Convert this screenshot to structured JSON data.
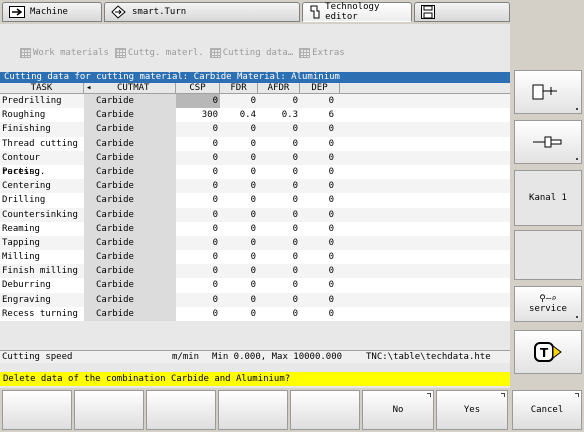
{
  "tabs": [
    {
      "label": "Machine",
      "icon": "arrow-right-icon"
    },
    {
      "label": "smart.Turn",
      "icon": "arrow-diamond-icon"
    },
    {
      "label": "Technology editor",
      "icon": "tool-icon"
    },
    {
      "label": "",
      "icon": "save-icon"
    }
  ],
  "menu": [
    "Work materials",
    "Cuttg. materl.",
    "Cutting data…",
    "Extras"
  ],
  "table": {
    "title": "Cutting data for cutting material: Carbide   Material: Aluminium",
    "columns": [
      "TASK",
      "CUTMAT",
      "CSP",
      "FDR",
      "AFDR",
      "DEP"
    ],
    "rows": [
      [
        "Predrilling",
        "Carbide",
        "0",
        "0",
        "0",
        "0"
      ],
      [
        "Roughing",
        "Carbide",
        "300",
        "0.4",
        "0.3",
        "6"
      ],
      [
        "Finishing",
        "Carbide",
        "0",
        "0",
        "0",
        "0"
      ],
      [
        "Thread cutting",
        "Carbide",
        "0",
        "0",
        "0",
        "0"
      ],
      [
        "Contour recessg.",
        "Carbide",
        "0",
        "0",
        "0",
        "0"
      ],
      [
        "Parting",
        "Carbide",
        "0",
        "0",
        "0",
        "0"
      ],
      [
        "Centering",
        "Carbide",
        "0",
        "0",
        "0",
        "0"
      ],
      [
        "Drilling",
        "Carbide",
        "0",
        "0",
        "0",
        "0"
      ],
      [
        "Countersinking",
        "Carbide",
        "0",
        "0",
        "0",
        "0"
      ],
      [
        "Reaming",
        "Carbide",
        "0",
        "0",
        "0",
        "0"
      ],
      [
        "Tapping",
        "Carbide",
        "0",
        "0",
        "0",
        "0"
      ],
      [
        "Milling",
        "Carbide",
        "0",
        "0",
        "0",
        "0"
      ],
      [
        "Finish milling",
        "Carbide",
        "0",
        "0",
        "0",
        "0"
      ],
      [
        "Deburring",
        "Carbide",
        "0",
        "0",
        "0",
        "0"
      ],
      [
        "Engraving",
        "Carbide",
        "0",
        "0",
        "0",
        "0"
      ],
      [
        "Recess turning",
        "Carbide",
        "0",
        "0",
        "0",
        "0"
      ]
    ]
  },
  "status": {
    "field": "Cutting speed",
    "unit": "m/min",
    "range": "Min 0.000, Max 10000.000",
    "path": "TNC:\\table\\techdata.hte"
  },
  "message": "Delete data of the combination Carbide and Aluminium?",
  "right_softkeys": [
    {
      "label": "",
      "icon": "tool-holder-icon"
    },
    {
      "label": "",
      "icon": "spindle-icon"
    },
    {
      "label": "Kanal 1",
      "icon": ""
    },
    {
      "label": "",
      "icon": ""
    },
    {
      "label": "service",
      "icon": "wrench-icon"
    },
    {
      "label": "",
      "icon": "tnc-icon"
    }
  ],
  "bottom_softkeys": [
    "",
    "",
    "",
    "",
    "",
    "No",
    "Yes",
    "Cancel"
  ],
  "colors": {
    "title_bar": "#2d6fb3",
    "message_bar": "#ffff00"
  }
}
